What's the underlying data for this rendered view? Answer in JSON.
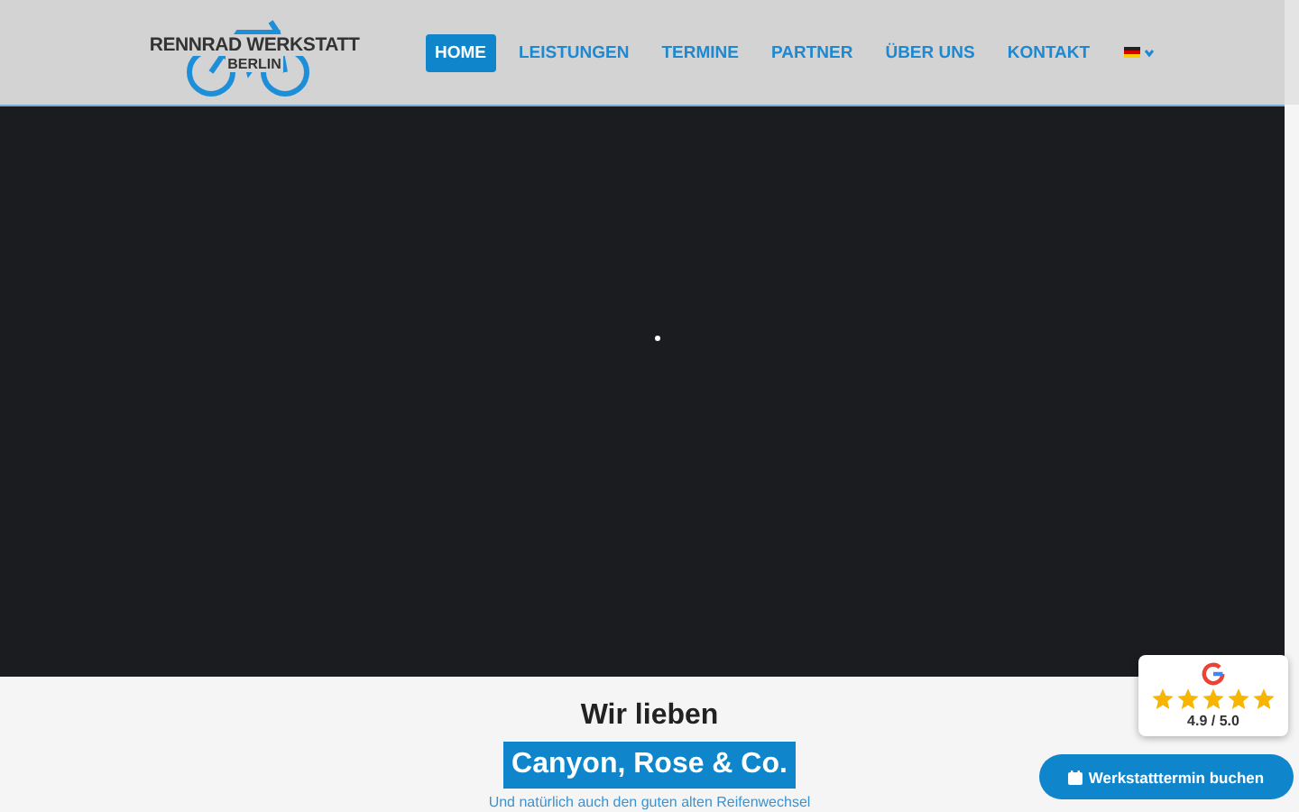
{
  "header": {
    "logo": {
      "line1": "RENNRAD WERKSTATT",
      "line2": "BERLIN"
    },
    "nav": [
      {
        "label": "HOME",
        "selected": true
      },
      {
        "label": "LEISTUNGEN",
        "selected": false
      },
      {
        "label": "TERMINE",
        "selected": false
      },
      {
        "label": "PARTNER",
        "selected": false
      },
      {
        "label": "ÜBER UNS",
        "selected": false
      },
      {
        "label": "KONTAKT",
        "selected": false
      }
    ]
  },
  "intro": {
    "heading": "Wir lieben",
    "highlight": "Canyon, Rose & Co.",
    "subtext": "Und natürlich auch den guten alten Reifenwechsel"
  },
  "rating": {
    "stars": 5,
    "score": "4.9 / 5.0"
  },
  "booking_button": {
    "label": "Werkstatttermin buchen"
  }
}
